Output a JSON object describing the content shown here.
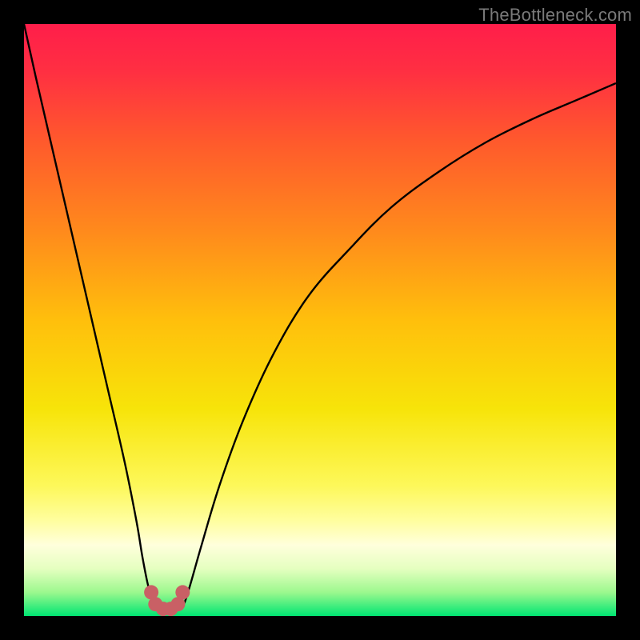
{
  "watermark": "TheBottleneck.com",
  "chart_data": {
    "type": "line",
    "title": "",
    "xlabel": "",
    "ylabel": "",
    "xlim": [
      0,
      100
    ],
    "ylim": [
      0,
      100
    ],
    "grid": false,
    "legend": false,
    "gradient_stops": [
      {
        "t": 0.0,
        "color": "#ff1e4a"
      },
      {
        "t": 0.08,
        "color": "#ff2f42"
      },
      {
        "t": 0.2,
        "color": "#ff5a2c"
      },
      {
        "t": 0.35,
        "color": "#ff8a1c"
      },
      {
        "t": 0.5,
        "color": "#ffbf0c"
      },
      {
        "t": 0.65,
        "color": "#f7e409"
      },
      {
        "t": 0.78,
        "color": "#fdf85a"
      },
      {
        "t": 0.84,
        "color": "#fffea0"
      },
      {
        "t": 0.88,
        "color": "#ffffdc"
      },
      {
        "t": 0.92,
        "color": "#e5ffc0"
      },
      {
        "t": 0.96,
        "color": "#9cf88e"
      },
      {
        "t": 1.0,
        "color": "#00e572"
      }
    ],
    "series": [
      {
        "name": "bottleneck-curve",
        "x": [
          0,
          2,
          5,
          8,
          11,
          14,
          17,
          19,
          20,
          21,
          22,
          23,
          24,
          25,
          26,
          27,
          28,
          30,
          33,
          37,
          42,
          48,
          55,
          62,
          70,
          78,
          86,
          93,
          100
        ],
        "y": [
          100,
          91,
          78,
          65,
          52,
          39,
          26,
          16,
          10,
          5,
          2,
          1,
          1,
          1,
          1,
          2,
          5,
          12,
          22,
          33,
          44,
          54,
          62,
          69,
          75,
          80,
          84,
          87,
          90
        ]
      }
    ],
    "markers": {
      "name": "min-region-dots",
      "color": "#c96065",
      "points": [
        {
          "x": 21.5,
          "y": 4.0
        },
        {
          "x": 22.2,
          "y": 2.0
        },
        {
          "x": 23.5,
          "y": 1.2
        },
        {
          "x": 24.8,
          "y": 1.2
        },
        {
          "x": 26.0,
          "y": 2.0
        },
        {
          "x": 26.8,
          "y": 4.0
        }
      ]
    }
  }
}
